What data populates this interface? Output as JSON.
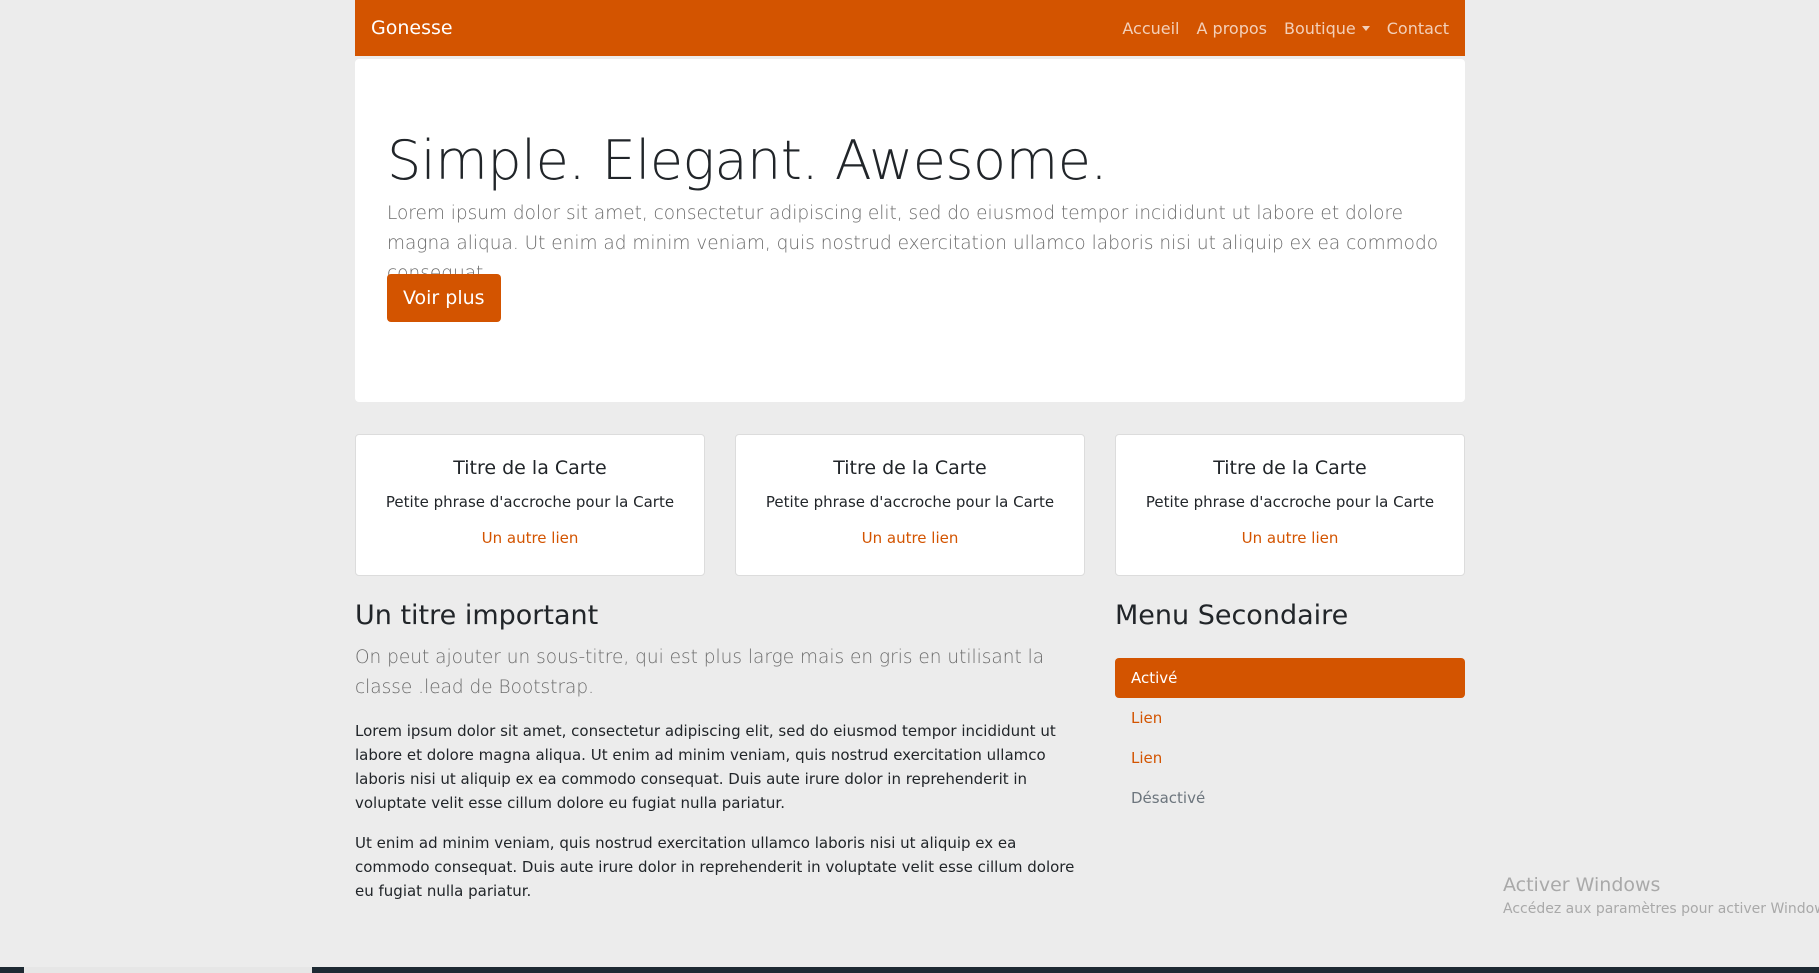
{
  "navbar": {
    "brand": "Gonesse",
    "links": [
      "Accueil",
      "A propos",
      "Boutique",
      "Contact"
    ]
  },
  "jumbotron": {
    "title": "Simple. Elegant. Awesome.",
    "lead": "Lorem ipsum dolor sit amet, consectetur adipiscing elit, sed do eiusmod tempor incididunt ut labore et dolore magna aliqua. Ut enim ad minim veniam, quis nostrud exercitation ullamco laboris nisi ut aliquip ex ea commodo consequat.",
    "button": "Voir plus"
  },
  "cards": [
    {
      "title": "Titre de la Carte",
      "text": "Petite phrase d'accroche pour la Carte",
      "link": "Un autre lien"
    },
    {
      "title": "Titre de la Carte",
      "text": "Petite phrase d'accroche pour la Carte",
      "link": "Un autre lien"
    },
    {
      "title": "Titre de la Carte",
      "text": "Petite phrase d'accroche pour la Carte",
      "link": "Un autre lien"
    }
  ],
  "main": {
    "title": "Un titre important",
    "lead": "On peut ajouter un sous-titre, qui est plus large mais en gris en utilisant la classe .lead de Bootstrap.",
    "paragraphs": [
      "Lorem ipsum dolor sit amet, consectetur adipiscing elit, sed do eiusmod tempor incididunt ut labore et dolore magna aliqua. Ut enim ad minim veniam, quis nostrud exercitation ullamco laboris nisi ut aliquip ex ea commodo consequat. Duis aute irure dolor in reprehenderit in voluptate velit esse cillum dolore eu fugiat nulla pariatur.",
      "Ut enim ad minim veniam, quis nostrud exercitation ullamco laboris nisi ut aliquip ex ea commodo consequat. Duis aute irure dolor in reprehenderit in voluptate velit esse cillum dolore eu fugiat nulla pariatur."
    ]
  },
  "sidebar": {
    "title": "Menu Secondaire",
    "items": [
      "Activé",
      "Lien",
      "Lien",
      "Désactivé"
    ]
  },
  "watermark": {
    "title": "Activer Windows",
    "subtitle": "Accédez aux paramètres pour activer Windows."
  },
  "colors": {
    "accent": "#d35400",
    "background": "#ececec"
  }
}
